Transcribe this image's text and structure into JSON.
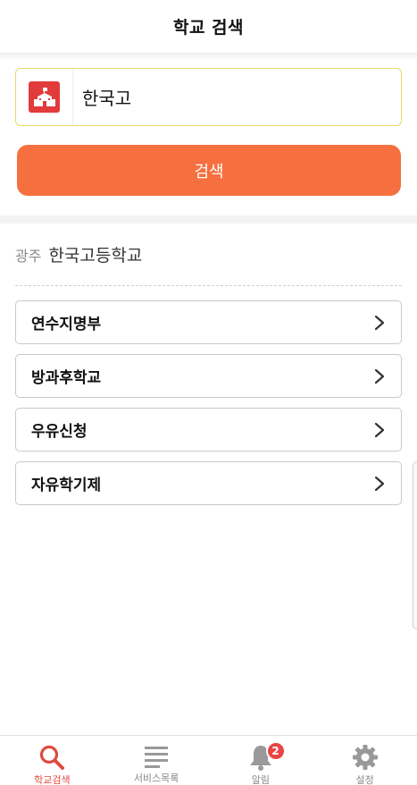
{
  "header": {
    "title": "학교 검색"
  },
  "search": {
    "value": "한국고",
    "icon": "school-building-icon",
    "button_label": "검색"
  },
  "colors": {
    "accent": "#f66f3e",
    "search_border": "#e7d96a",
    "icon_red": "#e23b3b",
    "active_nav": "#e04a3e"
  },
  "result": {
    "region": "광주",
    "school_name": "한국고등학교",
    "menu_items": [
      {
        "label": "연수지명부",
        "icon": "chevron-right-icon"
      },
      {
        "label": "방과후학교",
        "icon": "chevron-right-icon"
      },
      {
        "label": "우유신청",
        "icon": "chevron-right-icon"
      },
      {
        "label": "자유학기제",
        "icon": "chevron-right-icon"
      }
    ]
  },
  "bottom_nav": {
    "items": [
      {
        "label": "학교검색",
        "icon": "search-icon",
        "active": true
      },
      {
        "label": "서비스목록",
        "icon": "list-icon",
        "active": false
      },
      {
        "label": "알림",
        "icon": "bell-icon",
        "active": false,
        "badge": "2"
      },
      {
        "label": "설정",
        "icon": "gear-icon",
        "active": false
      }
    ]
  }
}
